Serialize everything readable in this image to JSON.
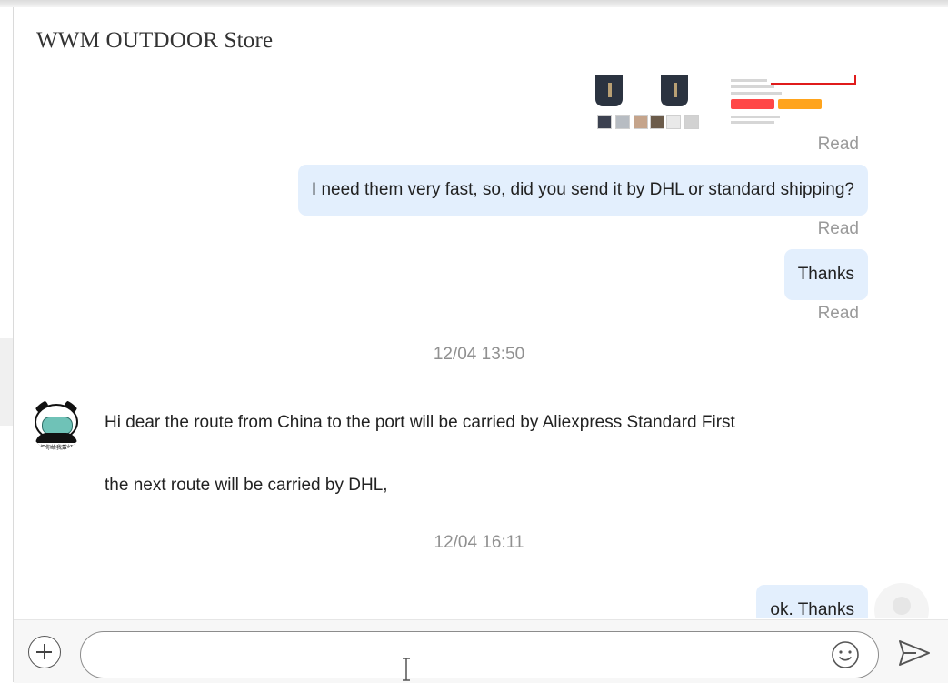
{
  "header": {
    "store_name": "WWM OUTDOOR Store"
  },
  "messages": [
    {
      "type": "outgoing-image",
      "status": "Read"
    },
    {
      "type": "outgoing",
      "text": "I need them very fast, so, did you send it by DHL or standard shipping?",
      "status": "Read"
    },
    {
      "type": "outgoing",
      "text": "Thanks",
      "status": "Read"
    },
    {
      "type": "timestamp",
      "text": "12/04 13:50"
    },
    {
      "type": "incoming",
      "lines": [
        "Hi dear the route from China to the port will be carried by Aliexpress Standard First",
        "the next route will be carried by DHL,"
      ]
    },
    {
      "type": "timestamp",
      "text": "12/04 16:11"
    },
    {
      "type": "outgoing",
      "text": "ok. Thanks"
    }
  ],
  "avatar": {
    "icon": "panda-mask-avatar",
    "caption": "把你给我戴好"
  },
  "composer": {
    "input_value": "",
    "placeholder": "",
    "add_icon": "plus-icon",
    "emoji_icon": "smiley-icon",
    "send_icon": "send-icon"
  },
  "colors": {
    "outgoing_bubble": "#e3effd",
    "status_text": "#9a9a9a",
    "timestamp_text": "#909090"
  }
}
